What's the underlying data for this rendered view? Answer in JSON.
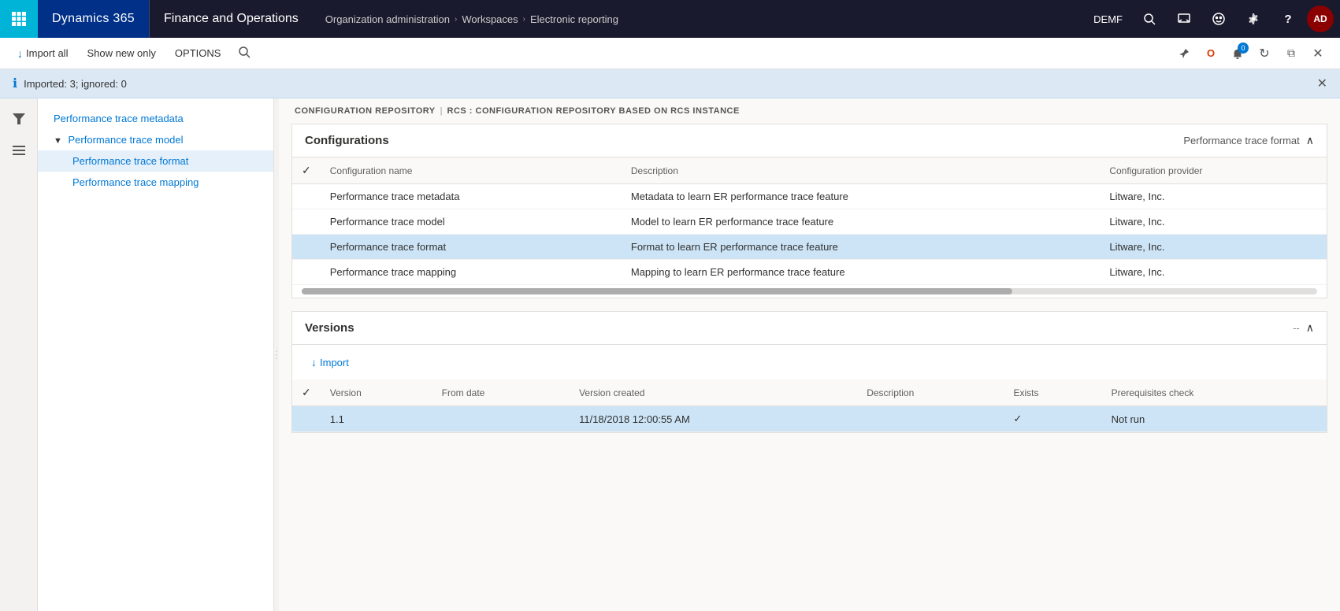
{
  "app": {
    "grid_icon": "⊞",
    "name": "Dynamics 365",
    "module": "Finance and Operations",
    "breadcrumb": [
      {
        "label": "Organization administration",
        "separator": "›"
      },
      {
        "label": "Workspaces",
        "separator": "›"
      },
      {
        "label": "Electronic reporting",
        "separator": ""
      }
    ]
  },
  "nav_right": {
    "env_label": "DEMF",
    "search_icon": "🔍",
    "message_icon": "💬",
    "face_icon": "🙂",
    "settings_icon": "⚙",
    "help_icon": "?",
    "avatar_label": "AD",
    "notification_count": "0"
  },
  "action_bar": {
    "import_label": "Import all",
    "show_new_only_label": "Show new only",
    "options_label": "OPTIONS",
    "search_placeholder": "Search"
  },
  "action_bar_right": {
    "pin_icon": "📌",
    "office_icon": "O",
    "bell_icon": "🔔",
    "refresh_icon": "↻",
    "window_icon": "⧉",
    "close_icon": "✕"
  },
  "info_banner": {
    "icon": "ℹ",
    "message": "Imported: 3; ignored: 0",
    "close_icon": "✕"
  },
  "left_icons": {
    "filter_icon": "⊤",
    "hamburger_icon": "≡"
  },
  "nav_tree": {
    "items": [
      {
        "id": "perf-trace-metadata",
        "label": "Performance trace metadata",
        "level": 0,
        "selected": false,
        "expanded": false,
        "has_children": false
      },
      {
        "id": "perf-trace-model",
        "label": "Performance trace model",
        "level": 0,
        "selected": false,
        "expanded": true,
        "has_children": true,
        "collapse_icon": "▼"
      },
      {
        "id": "perf-trace-format",
        "label": "Performance trace format",
        "level": 1,
        "selected": true,
        "expanded": false,
        "has_children": false
      },
      {
        "id": "perf-trace-mapping",
        "label": "Performance trace mapping",
        "level": 1,
        "selected": false,
        "expanded": false,
        "has_children": false
      }
    ]
  },
  "content_breadcrumb": {
    "parts": [
      {
        "label": "CONFIGURATION REPOSITORY"
      },
      {
        "sep": "|"
      },
      {
        "label": "RCS : CONFIGURATION REPOSITORY BASED ON RCS INSTANCE"
      }
    ]
  },
  "configurations_card": {
    "title": "Configurations",
    "right_label": "Performance trace format",
    "collapse_icon": "∧",
    "table": {
      "columns": [
        {
          "id": "check",
          "label": ""
        },
        {
          "id": "name",
          "label": "Configuration name"
        },
        {
          "id": "description",
          "label": "Description"
        },
        {
          "id": "provider",
          "label": "Configuration provider"
        }
      ],
      "rows": [
        {
          "id": "row-metadata",
          "name": "Performance trace metadata",
          "description": "Metadata to learn ER performance trace feature",
          "provider": "Litware, Inc.",
          "selected": false,
          "check": ""
        },
        {
          "id": "row-model",
          "name": "Performance trace model",
          "description": "Model to learn ER performance trace feature",
          "provider": "Litware, Inc.",
          "selected": false,
          "check": ""
        },
        {
          "id": "row-format",
          "name": "Performance trace format",
          "description": "Format to learn ER performance trace feature",
          "provider": "Litware, Inc.",
          "selected": true,
          "check": ""
        },
        {
          "id": "row-mapping",
          "name": "Performance trace mapping",
          "description": "Mapping to learn ER performance trace feature",
          "provider": "Litware, Inc.",
          "selected": false,
          "check": ""
        }
      ]
    }
  },
  "versions_card": {
    "title": "Versions",
    "collapse_icon": "∧",
    "dash_icon": "--",
    "import_btn_label": "Import",
    "import_icon": "↓",
    "table": {
      "columns": [
        {
          "id": "check",
          "label": ""
        },
        {
          "id": "version",
          "label": "Version"
        },
        {
          "id": "from_date",
          "label": "From date"
        },
        {
          "id": "version_created",
          "label": "Version created"
        },
        {
          "id": "description",
          "label": "Description"
        },
        {
          "id": "exists",
          "label": "Exists"
        },
        {
          "id": "prereq",
          "label": "Prerequisites check"
        }
      ],
      "rows": [
        {
          "id": "ver-row-1",
          "check": "",
          "version": "1.1",
          "from_date": "",
          "version_created": "11/18/2018 12:00:55 AM",
          "description": "",
          "exists": "✓",
          "prereq": "Not run",
          "selected": true
        }
      ]
    }
  }
}
